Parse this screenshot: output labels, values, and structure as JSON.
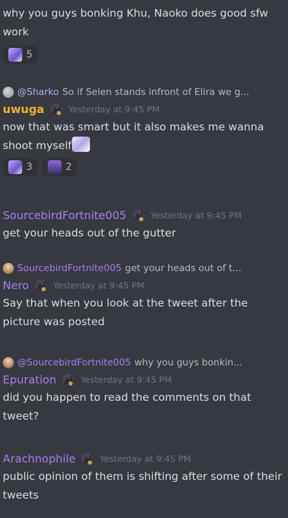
{
  "messages": [
    {
      "text": "why you guys bonking Khu, Naoko does good sfw work",
      "reactions": [
        {
          "emoji": "vtuber-emoji",
          "count": "5"
        }
      ]
    },
    {
      "reply": {
        "mention": "@Sharko",
        "preview": "So if Selen stands infront of Elira we g..."
      },
      "username": "uwuga",
      "username_color": "#f0b232",
      "timestamp": "Yesterday at 9:45 PM",
      "text": "now that was smart but it also makes me wanna shoot myself",
      "reactions": [
        {
          "emoji": "vtuber-emoji",
          "count": "3"
        },
        {
          "emoji": "dragon-emoji",
          "count": "2"
        }
      ]
    },
    {
      "username": "SourcebirdFortnite005",
      "username_color": "#a77ff4",
      "timestamp": "Yesterday at 9:45 PM",
      "text": "get your heads out of the gutter"
    },
    {
      "reply": {
        "mention": "SourcebirdFortnite005",
        "preview": "get your heads out of t..."
      },
      "username": "Nero",
      "username_color": "#a77ff4",
      "timestamp": "Yesterday at 9:45 PM",
      "text": "Say that when you look at the tweet after the picture was posted"
    },
    {
      "reply": {
        "mention": "@SourcebirdFortnite005",
        "preview": "why you guys bonkin..."
      },
      "username": "Epuration",
      "username_color": "#a77ff4",
      "timestamp": "Yesterday at 9:45 PM",
      "text": "did you happen to read the comments on that tweet?"
    },
    {
      "username": "Arachnophile",
      "username_color": "#a77ff4",
      "timestamp": "Yesterday at 9:45 PM",
      "text": "public opinion of them is shifting after some of their tweets"
    }
  ]
}
